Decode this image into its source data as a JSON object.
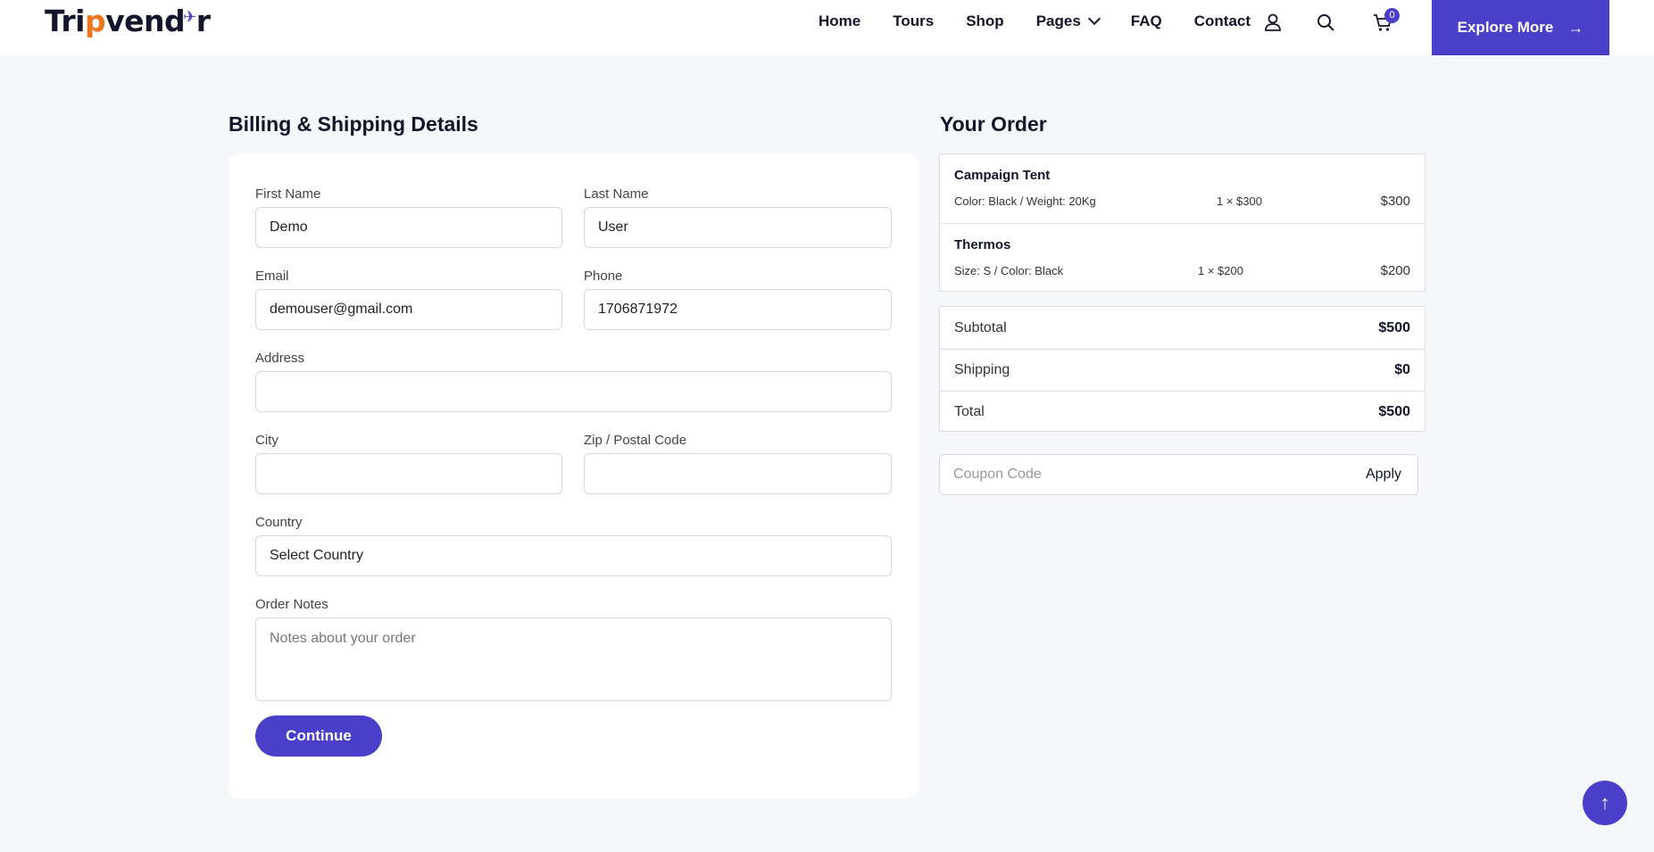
{
  "brand": {
    "logo_left": "Tri",
    "logo_accent": "p",
    "logo_mid": "vend",
    "logo_plane": "✈",
    "logo_right": "r",
    "colors": {
      "primary": "#4a3fc9",
      "accent": "#f0761d",
      "background": "#f6f7fb"
    }
  },
  "nav": {
    "items": [
      "Home",
      "Tours",
      "Shop",
      "Pages",
      "FAQ",
      "Contact"
    ],
    "cart_count": "0",
    "explore_label": "Explore More",
    "icons": [
      "user-icon",
      "search-icon",
      "cart-icon",
      "chevron-down-icon",
      "arrow-right-icon"
    ]
  },
  "billing": {
    "title": "Billing & Shipping Details",
    "first_name": {
      "label": "First Name",
      "value": "Demo"
    },
    "last_name": {
      "label": "Last Name",
      "value": "User"
    },
    "email": {
      "label": "Email",
      "value": "demouser@gmail.com"
    },
    "phone": {
      "label": "Phone",
      "value": "1706871972"
    },
    "address": {
      "label": "Address",
      "value": ""
    },
    "city": {
      "label": "City",
      "value": ""
    },
    "zip": {
      "label": "Zip / Postal Code",
      "value": ""
    },
    "country": {
      "label": "Country",
      "value": "Select Country"
    },
    "notes": {
      "label": "Order Notes",
      "placeholder": "Notes about your order"
    },
    "continue_label": "Continue"
  },
  "order": {
    "title": "Your Order",
    "items": [
      {
        "name": "Campaign Tent",
        "variant": "Color: Black / Weight: 20Kg",
        "qty": "1 × $300",
        "total": "$300"
      },
      {
        "name": "Thermos",
        "variant": "Size: S / Color: Black",
        "qty": "1 × $200",
        "total": "$200"
      }
    ],
    "totals": [
      {
        "label": "Subtotal",
        "value": "$500"
      },
      {
        "label": "Shipping",
        "value": "$0"
      },
      {
        "label": "Total",
        "value": "$500"
      }
    ],
    "coupon_placeholder": "Coupon Code",
    "apply_label": "Apply"
  },
  "scroll_top_icon": "↑"
}
